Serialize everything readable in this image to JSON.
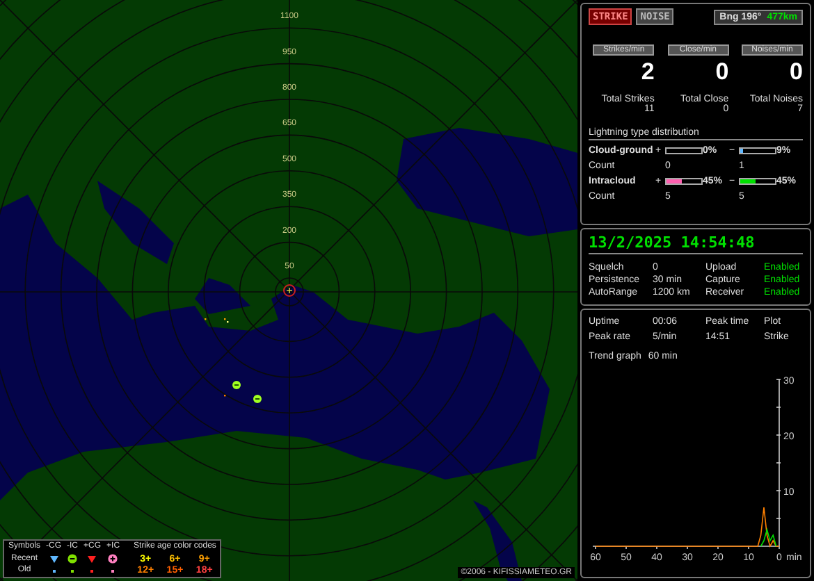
{
  "map": {
    "range_labels": [
      "1100",
      "950",
      "800",
      "650",
      "500",
      "350",
      "200",
      "50"
    ],
    "copyright": "©2006 - KIFISSIAMETEO.GR"
  },
  "legend": {
    "title": "Symbols",
    "age_title": "Strike age color codes",
    "symbols": [
      {
        "label": "-CG",
        "kind": "triangle",
        "color": "#60b8ff"
      },
      {
        "label": "-IC",
        "kind": "minus",
        "color": "#80e000"
      },
      {
        "label": "+CG",
        "kind": "triangle",
        "color": "#ff2020"
      },
      {
        "label": "+IC",
        "kind": "plus",
        "color": "#ff80c0"
      }
    ],
    "rows": [
      {
        "label": "Recent",
        "kind": "icon",
        "ages": [
          {
            "label": "3+",
            "color": "#ffff00"
          },
          {
            "label": "6+",
            "color": "#ffc000"
          },
          {
            "label": "9+",
            "color": "#ffa000"
          }
        ]
      },
      {
        "label": "Old",
        "kind": "dot",
        "ages": [
          {
            "label": "12+",
            "color": "#ff8000"
          },
          {
            "label": "15+",
            "color": "#ff6000"
          },
          {
            "label": "18+",
            "color": "#ff4040"
          }
        ]
      }
    ]
  },
  "status": {
    "tabs": [
      {
        "label": "STRIKE",
        "selected": true
      },
      {
        "label": "NOISE",
        "selected": false
      }
    ],
    "bearing": "Bng 196°",
    "distance": "477km"
  },
  "rates": [
    {
      "label": "Strikes/min",
      "value": "2",
      "total_label": "Total Strikes",
      "total": "11"
    },
    {
      "label": "Close/min",
      "value": "0",
      "total_label": "Total Close",
      "total": "0"
    },
    {
      "label": "Noises/min",
      "value": "0",
      "total_label": "Total Noises",
      "total": "7"
    }
  ],
  "distribution": {
    "title": "Lightning type distribution",
    "types": [
      {
        "name": "Cloud-ground",
        "count_label": "Count",
        "bars": [
          {
            "sign": "+",
            "level": 0,
            "reading": "0%",
            "count": "0"
          },
          {
            "sign": "−",
            "level": 0.09,
            "reading": "9%",
            "color": "#60b8ff",
            "count": "1"
          }
        ]
      },
      {
        "name": "Intracloud",
        "count_label": "Count",
        "bars": [
          {
            "sign": "+",
            "level": 0.45,
            "reading": "45%",
            "color": "#ff60b0",
            "count": "5"
          },
          {
            "sign": "−",
            "level": 0.45,
            "reading": "45%",
            "color": "#00e000",
            "count": "5"
          }
        ]
      }
    ]
  },
  "clock": {
    "datetime": "13/2/2025 14:54:48",
    "settings": [
      {
        "label": "Squelch",
        "value": "0",
        "feature": "Upload",
        "state": "Enabled"
      },
      {
        "label": "Persistence",
        "value": "30 min",
        "feature": "Capture",
        "state": "Enabled"
      },
      {
        "label": "AutoRange",
        "value": "1200 km",
        "feature": "Receiver",
        "state": "Enabled"
      }
    ]
  },
  "stats": {
    "rows": [
      [
        "Uptime",
        "00:06",
        "Peak time",
        "Plot"
      ],
      [
        "Peak rate",
        "5/min",
        "14:51",
        "Strike"
      ]
    ]
  },
  "trend": {
    "label": "Trend graph",
    "window": "60 min",
    "chart_data": {
      "type": "line",
      "xlabel": "min",
      "x": [
        60,
        10,
        7,
        6,
        5,
        4,
        3,
        2,
        1,
        0
      ],
      "xlim": [
        60,
        0
      ],
      "ylim": [
        0,
        30
      ],
      "xticks": [
        60,
        50,
        40,
        30,
        20,
        10,
        0
      ],
      "yticks": [
        10,
        20,
        30
      ],
      "series": [
        {
          "color": "#ff8000",
          "values": [
            0,
            0,
            0,
            2,
            7,
            2,
            0,
            1,
            0,
            0
          ]
        },
        {
          "color": "#00e000",
          "values": [
            null,
            null,
            null,
            0,
            1,
            3,
            1,
            2,
            0,
            null
          ]
        }
      ]
    }
  }
}
